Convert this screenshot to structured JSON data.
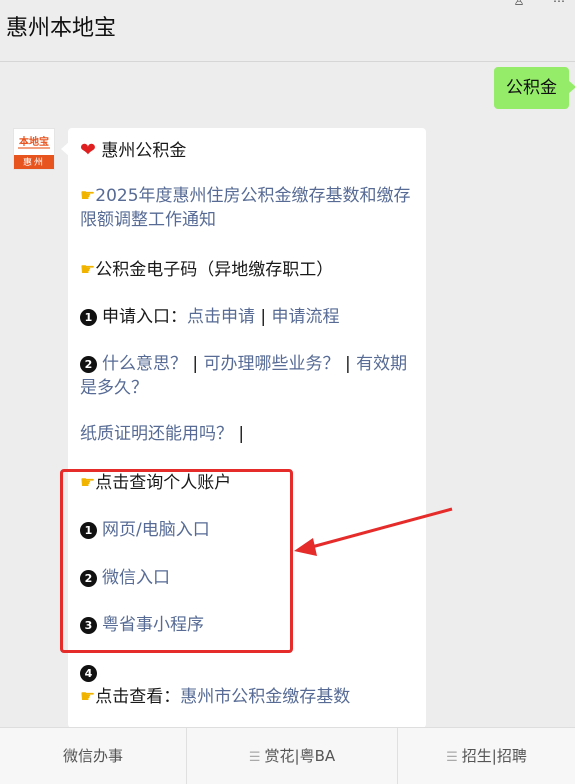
{
  "header": {
    "title": "惠州本地宝"
  },
  "chat": {
    "user_message": "公积金",
    "avatar": {
      "logo_text": "本地宝",
      "city": "惠州"
    },
    "reply": {
      "title": "惠州公积金",
      "notice_link": "2025年度惠州住房公积金缴存基数和缴存限额调整工作通知",
      "ecode": "公积金电子码（异地缴存职工）",
      "apply_prefix": "申请入口：",
      "apply_link": "点击申请",
      "sep": "|",
      "process_link": "申请流程",
      "q_meaning": "什么意思？",
      "q_business": "可办理哪些业务？",
      "q_validity": "有效期是多久？",
      "q_paper": "纸质证明还能用吗？",
      "query_title": "点击查询个人账户",
      "entry_web": "网页/电脑入口",
      "entry_wechat": "微信入口",
      "entry_miniapp": "粤省事小程序",
      "view_prefix": "点击查看：",
      "view_link": "惠州市公积金缴存基数",
      "nums": [
        "1",
        "2",
        "1",
        "2",
        "3",
        "4"
      ]
    }
  },
  "menu": {
    "items": [
      "微信办事",
      "赏花|粤BA",
      "招生|招聘"
    ]
  },
  "colors": {
    "link": "#576b95",
    "bubble_out": "#95ec69",
    "highlight": "#e62b2b"
  }
}
